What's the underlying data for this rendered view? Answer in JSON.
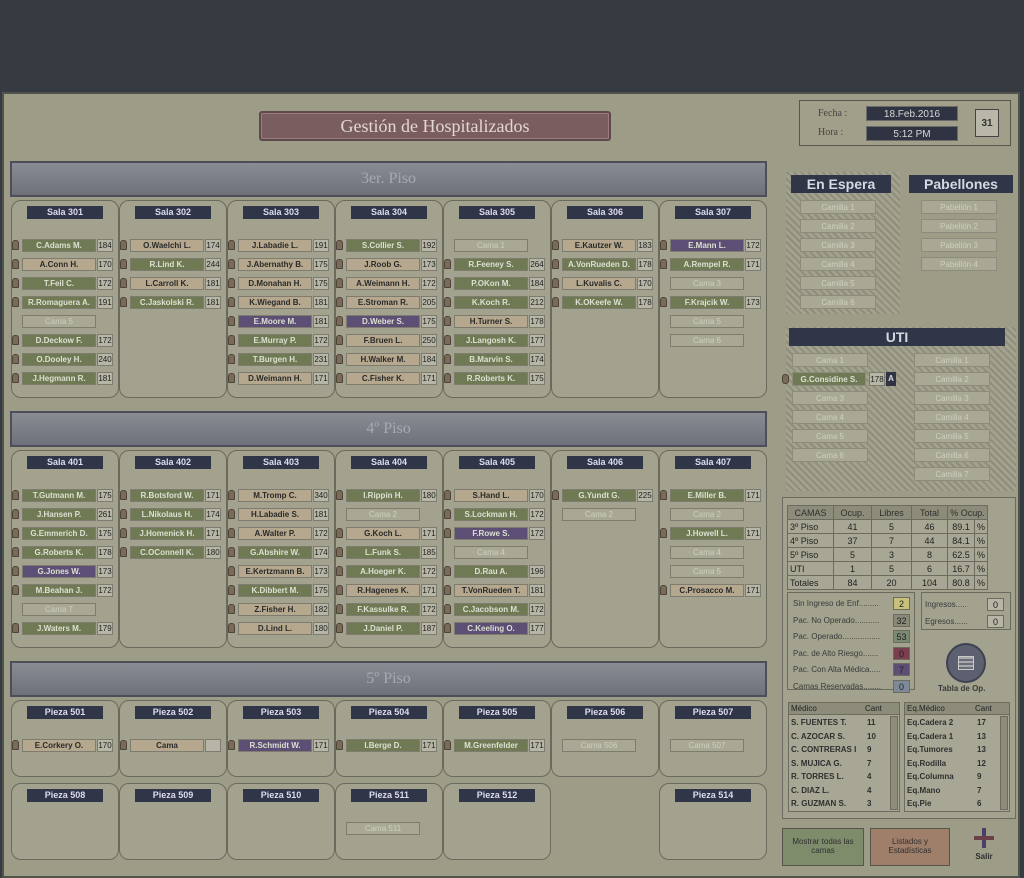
{
  "title": "Gestión de Hospitalizados",
  "fecha_label": "Fecha :",
  "fecha": "18.Feb.2016",
  "hora_label": "Hora :",
  "hora": "5:12 PM",
  "calendar_glyph": "31",
  "floors": [
    "3er. Piso",
    "4º Piso",
    "5º Piso"
  ],
  "salas3": [
    {
      "name": "Sala 301",
      "beds": [
        [
          "C.Adams M.",
          "184",
          "g"
        ],
        [
          "A.Conn H.",
          "170",
          "t"
        ],
        [
          "T.Feil C.",
          "172",
          "g"
        ],
        [
          "R.Romaguera A.",
          "191",
          "g"
        ],
        [
          "Cama 5",
          "",
          "e"
        ],
        [
          "D.Deckow F.",
          "172",
          "g"
        ],
        [
          "O.Dooley H.",
          "240",
          "g"
        ],
        [
          "J.Hegmann R.",
          "181",
          "g"
        ]
      ]
    },
    {
      "name": "Sala 302",
      "beds": [
        [
          "O.Waelchi L.",
          "174",
          "t"
        ],
        [
          "R.Lind K.",
          "244",
          "g"
        ],
        [
          "L.Carroll K.",
          "181",
          "t"
        ],
        [
          "C.Jaskolski R.",
          "181",
          "g"
        ]
      ]
    },
    {
      "name": "Sala 303",
      "beds": [
        [
          "J.Labadie L.",
          "191",
          "t"
        ],
        [
          "J.Abernathy B.",
          "175",
          "t"
        ],
        [
          "D.Monahan H.",
          "175",
          "t"
        ],
        [
          "K.Wiegand B.",
          "181",
          "t"
        ],
        [
          "E.Moore M.",
          "181",
          "p"
        ],
        [
          "E.Murray P.",
          "172",
          "g"
        ],
        [
          "T.Burgen H.",
          "231",
          "g"
        ],
        [
          "D.Weimann H.",
          "171",
          "t"
        ]
      ]
    },
    {
      "name": "Sala 304",
      "beds": [
        [
          "S.Collier S.",
          "192",
          "g"
        ],
        [
          "J.Roob G.",
          "173",
          "t"
        ],
        [
          "A.Weimann H.",
          "172",
          "t"
        ],
        [
          "E.Stroman R.",
          "205",
          "t"
        ],
        [
          "D.Weber S.",
          "175",
          "p"
        ],
        [
          "F.Bruen L.",
          "250",
          "t"
        ],
        [
          "H.Walker M.",
          "184",
          "t"
        ],
        [
          "C.Fisher K.",
          "171",
          "t"
        ]
      ]
    },
    {
      "name": "Sala 305",
      "beds": [
        [
          "Cama 1",
          "",
          "e"
        ],
        [
          "R.Feeney S.",
          "264",
          "g"
        ],
        [
          "P.OKon M.",
          "184",
          "g"
        ],
        [
          "K.Koch R.",
          "212",
          "g"
        ],
        [
          "H.Turner S.",
          "178",
          "t"
        ],
        [
          "J.Langosh K.",
          "177",
          "g"
        ],
        [
          "B.Marvin S.",
          "174",
          "g"
        ],
        [
          "R.Roberts K.",
          "175",
          "g"
        ]
      ]
    },
    {
      "name": "Sala 306",
      "beds": [
        [
          "E.Kautzer W.",
          "183",
          "t"
        ],
        [
          "A.VonRueden D.",
          "178",
          "g"
        ],
        [
          "L.Kuvalis C.",
          "170",
          "t"
        ],
        [
          "K.OKeefe W.",
          "178",
          "g"
        ]
      ]
    },
    {
      "name": "Sala 307",
      "beds": [
        [
          "E.Mann L.",
          "172",
          "p"
        ],
        [
          "A.Rempel R.",
          "171",
          "g"
        ],
        [
          "Cama 3",
          "",
          "e"
        ],
        [
          "F.Krajcik W.",
          "173",
          "g"
        ],
        [
          "Cama 5",
          "",
          "e"
        ],
        [
          "Cama 6",
          "",
          "e"
        ]
      ]
    }
  ],
  "salas4": [
    {
      "name": "Sala 401",
      "beds": [
        [
          "T.Gutmann M.",
          "175",
          "g"
        ],
        [
          "J.Hansen P.",
          "261",
          "g"
        ],
        [
          "G.Emmerich D.",
          "175",
          "g"
        ],
        [
          "G.Roberts K.",
          "178",
          "g"
        ],
        [
          "G.Jones W.",
          "173",
          "p"
        ],
        [
          "M.Beahan J.",
          "172",
          "g"
        ],
        [
          "Cama 7",
          "",
          "e"
        ],
        [
          "J.Waters M.",
          "179",
          "g"
        ]
      ]
    },
    {
      "name": "Sala 402",
      "beds": [
        [
          "R.Botsford W.",
          "171",
          "g"
        ],
        [
          "L.Nikolaus H.",
          "174",
          "g"
        ],
        [
          "J.Homenick H.",
          "171",
          "g"
        ],
        [
          "C.OConnell K.",
          "180",
          "g"
        ]
      ]
    },
    {
      "name": "Sala 403",
      "beds": [
        [
          "M.Tromp C.",
          "340",
          "t"
        ],
        [
          "H.Labadie S.",
          "181",
          "t"
        ],
        [
          "A.Walter P.",
          "172",
          "t"
        ],
        [
          "G.Abshire W.",
          "174",
          "g"
        ],
        [
          "E.Kertzmann B.",
          "173",
          "t"
        ],
        [
          "K.Dibbert M.",
          "175",
          "g"
        ],
        [
          "Z.Fisher H.",
          "182",
          "t"
        ],
        [
          "D.Lind L.",
          "180",
          "t"
        ]
      ]
    },
    {
      "name": "Sala 404",
      "beds": [
        [
          "I.Rippin H.",
          "180",
          "g"
        ],
        [
          "Cama 2",
          "",
          "e"
        ],
        [
          "G.Koch L.",
          "171",
          "t"
        ],
        [
          "L.Funk S.",
          "185",
          "g"
        ],
        [
          "A.Hoeger K.",
          "172",
          "g"
        ],
        [
          "R.Hagenes K.",
          "171",
          "t"
        ],
        [
          "F.Kassulke R.",
          "172",
          "g"
        ],
        [
          "J.Daniel P.",
          "187",
          "g"
        ]
      ]
    },
    {
      "name": "Sala 405",
      "beds": [
        [
          "S.Hand L.",
          "170",
          "t"
        ],
        [
          "S.Lockman H.",
          "172",
          "g"
        ],
        [
          "F.Rowe S.",
          "172",
          "p"
        ],
        [
          "Cama 4",
          "",
          "e"
        ],
        [
          "D.Rau A.",
          "196",
          "g"
        ],
        [
          "T.VonRueden T.",
          "181",
          "t"
        ],
        [
          "C.Jacobson M.",
          "172",
          "g"
        ],
        [
          "C.Keeling O.",
          "177",
          "p"
        ]
      ]
    },
    {
      "name": "Sala 406",
      "beds": [
        [
          "G.Yundt G.",
          "225",
          "g"
        ],
        [
          "Cama 2",
          "",
          "e"
        ]
      ]
    },
    {
      "name": "Sala 407",
      "beds": [
        [
          "E.Miller B.",
          "171",
          "g"
        ],
        [
          "Cama 2",
          "",
          "e"
        ],
        [
          "J.Howell L.",
          "171",
          "g"
        ],
        [
          "Cama 4",
          "",
          "e"
        ],
        [
          "Cama 5",
          "",
          "e"
        ],
        [
          "C.Prosacco M.",
          "171",
          "t"
        ]
      ]
    }
  ],
  "piezas5": [
    {
      "name": "Pieza 501",
      "beds": [
        [
          "E.Corkery O.",
          "170",
          "t"
        ]
      ]
    },
    {
      "name": "Pieza 502",
      "beds": [
        [
          "Cama",
          "",
          "t"
        ]
      ]
    },
    {
      "name": "Pieza 503",
      "beds": [
        [
          "R.Schmidt W.",
          "171",
          "p"
        ]
      ]
    },
    {
      "name": "Pieza 504",
      "beds": [
        [
          "I.Berge D.",
          "171",
          "g"
        ]
      ]
    },
    {
      "name": "Pieza 505",
      "beds": [
        [
          "M.Greenfelder",
          "171",
          "g"
        ]
      ]
    },
    {
      "name": "Pieza 506",
      "beds": [
        [
          "Cama 506",
          "",
          "e"
        ]
      ]
    },
    {
      "name": "Pieza 507",
      "beds": [
        [
          "Cama 507",
          "",
          "e"
        ]
      ]
    },
    {
      "name": "Pieza 508",
      "beds": []
    },
    {
      "name": "Pieza 509",
      "beds": []
    },
    {
      "name": "Pieza 510",
      "beds": []
    },
    {
      "name": "Pieza 511",
      "beds": [
        [
          "Cama 511",
          "",
          "e"
        ]
      ]
    },
    {
      "name": "Pieza 512",
      "beds": []
    },
    {
      "name": "Pieza 514",
      "beds": []
    }
  ],
  "en_espera": {
    "title": "En Espera",
    "items": [
      "Camilla 1",
      "Camilla 2",
      "Camilla 3",
      "Camilla 4",
      "Camilla 5",
      "Camilla 6"
    ]
  },
  "pabellones": {
    "title": "Pabellones",
    "items": [
      "Pabellón 1",
      "Pabellón 2",
      "Pabellón 3",
      "Pabellón 4"
    ]
  },
  "uti": {
    "title": "UTI",
    "camas": [
      "Cama 1",
      "G.Considine S.",
      "Cama 3",
      "Cama 4",
      "Cama 5",
      "Cama 6"
    ],
    "occupied_age": "178",
    "occupied_flag": "A",
    "camillas": [
      "Camilla 1",
      "Camilla 2",
      "Camilla 3",
      "Camilla 4",
      "Camilla 5",
      "Camilla 6",
      "Camilla 7"
    ]
  },
  "camas_table": {
    "headers": [
      "CAMAS",
      "Ocup.",
      "Libres",
      "Total",
      "% Ocup."
    ],
    "rows": [
      [
        "3º Piso",
        "41",
        "5",
        "46",
        "89.1",
        "%"
      ],
      [
        "4º Piso",
        "37",
        "7",
        "44",
        "84.1",
        "%"
      ],
      [
        "5º Piso",
        "5",
        "3",
        "8",
        "62.5",
        "%"
      ],
      [
        "UTI",
        "1",
        "5",
        "6",
        "16.7",
        "%"
      ],
      [
        "Totales",
        "84",
        "20",
        "104",
        "80.8",
        "%"
      ]
    ]
  },
  "stats": [
    [
      "Sin Ingreso de Enf.........",
      "2",
      "#c9c07a"
    ],
    [
      "Pac. No Operado...........",
      "32",
      "#8a8878"
    ],
    [
      "Pac. Operado.................",
      "53",
      "#7b8a73"
    ],
    [
      "Pac. de Alto Riesgo.......",
      "0",
      "#7a3f4e"
    ],
    [
      "Pac. Con Alta Médica.....",
      "7",
      "#5d4e75"
    ],
    [
      "Camas Reservadas........",
      "0",
      "#7d8998"
    ]
  ],
  "ingresos_label": "Ingresos.....",
  "ingresos": "0",
  "egresos_label": "Egresos......",
  "egresos": "0",
  "tabla_op": "Tabla de Op.",
  "medicos": {
    "headers": [
      "Médico",
      "Cant"
    ],
    "rows": [
      [
        "S. FUENTES T.",
        "11"
      ],
      [
        "C. AZOCAR S.",
        "10"
      ],
      [
        "C. CONTRERAS I",
        "9"
      ],
      [
        "S. MUJICA G.",
        "7"
      ],
      [
        "R. TORRES L.",
        "4"
      ],
      [
        "C. DIAZ L.",
        "4"
      ],
      [
        "R. GUZMAN S.",
        "3"
      ]
    ]
  },
  "equipos": {
    "headers": [
      "Eq.Médico",
      "Cant"
    ],
    "rows": [
      [
        "Eq.Cadera 2",
        "17"
      ],
      [
        "Eq.Cadera 1",
        "13"
      ],
      [
        "Eq.Tumores",
        "13"
      ],
      [
        "Eq.Rodilla",
        "12"
      ],
      [
        "Eq.Columna",
        "9"
      ],
      [
        "Eq.Mano",
        "7"
      ],
      [
        "Eq.Pie",
        "6"
      ]
    ]
  },
  "buttons": {
    "mostrar": "Mostrar todas las camas",
    "listados": "Listados y Estadísticas",
    "salir": "Salir"
  },
  "colors": {
    "occupied": "#6f7a55",
    "purple": "#5d4e75",
    "tan": "#b5a88e",
    "empty": "#a8a895",
    "header": "#303548",
    "background": "#9d9c86"
  }
}
